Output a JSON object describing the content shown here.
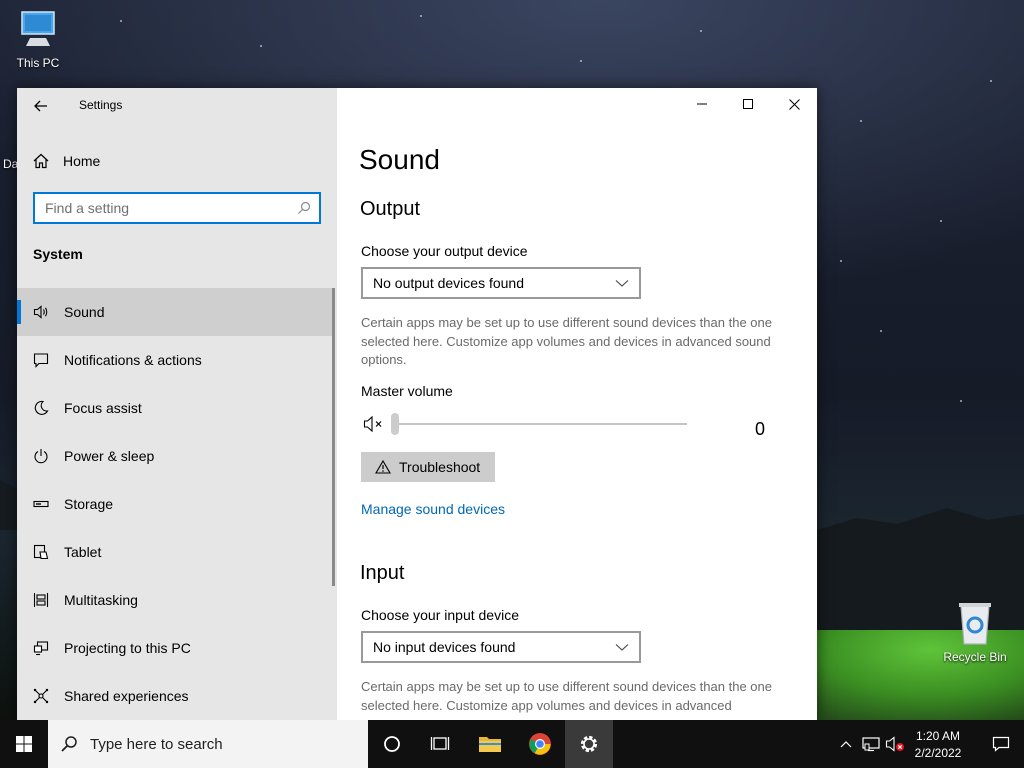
{
  "desktop": {
    "icons": [
      {
        "label": "This PC"
      },
      {
        "label": "Recycle Bin"
      }
    ],
    "partial_text": "Da"
  },
  "window": {
    "app_title": "Settings",
    "home_label": "Home",
    "search_placeholder": "Find a setting",
    "section_label": "System",
    "nav_items": [
      {
        "label": "Sound",
        "icon": "speaker-icon",
        "active": true
      },
      {
        "label": "Notifications & actions",
        "icon": "notifications-icon"
      },
      {
        "label": "Focus assist",
        "icon": "moon-icon"
      },
      {
        "label": "Power & sleep",
        "icon": "power-icon"
      },
      {
        "label": "Storage",
        "icon": "storage-icon"
      },
      {
        "label": "Tablet",
        "icon": "tablet-icon"
      },
      {
        "label": "Multitasking",
        "icon": "multitasking-icon"
      },
      {
        "label": "Projecting to this PC",
        "icon": "projecting-icon"
      },
      {
        "label": "Shared experiences",
        "icon": "shared-icon"
      }
    ],
    "accent_color": "#0078d7"
  },
  "content": {
    "page_title": "Sound",
    "output": {
      "heading": "Output",
      "device_label": "Choose your output device",
      "device_value": "No output devices found",
      "description": "Certain apps may be set up to use different sound devices than the one selected here. Customize app volumes and devices in advanced sound options.",
      "volume_label": "Master volume",
      "volume_value": "0",
      "troubleshoot_label": "Troubleshoot",
      "manage_link": "Manage sound devices"
    },
    "input": {
      "heading": "Input",
      "device_label": "Choose your input device",
      "device_value": "No input devices found",
      "description": "Certain apps may be set up to use different sound devices than the one selected here. Customize app volumes and devices in advanced"
    },
    "link_color": "#0067b8"
  },
  "taskbar": {
    "search_placeholder": "Type here to search",
    "time": "1:20 AM",
    "date": "2/2/2022"
  }
}
